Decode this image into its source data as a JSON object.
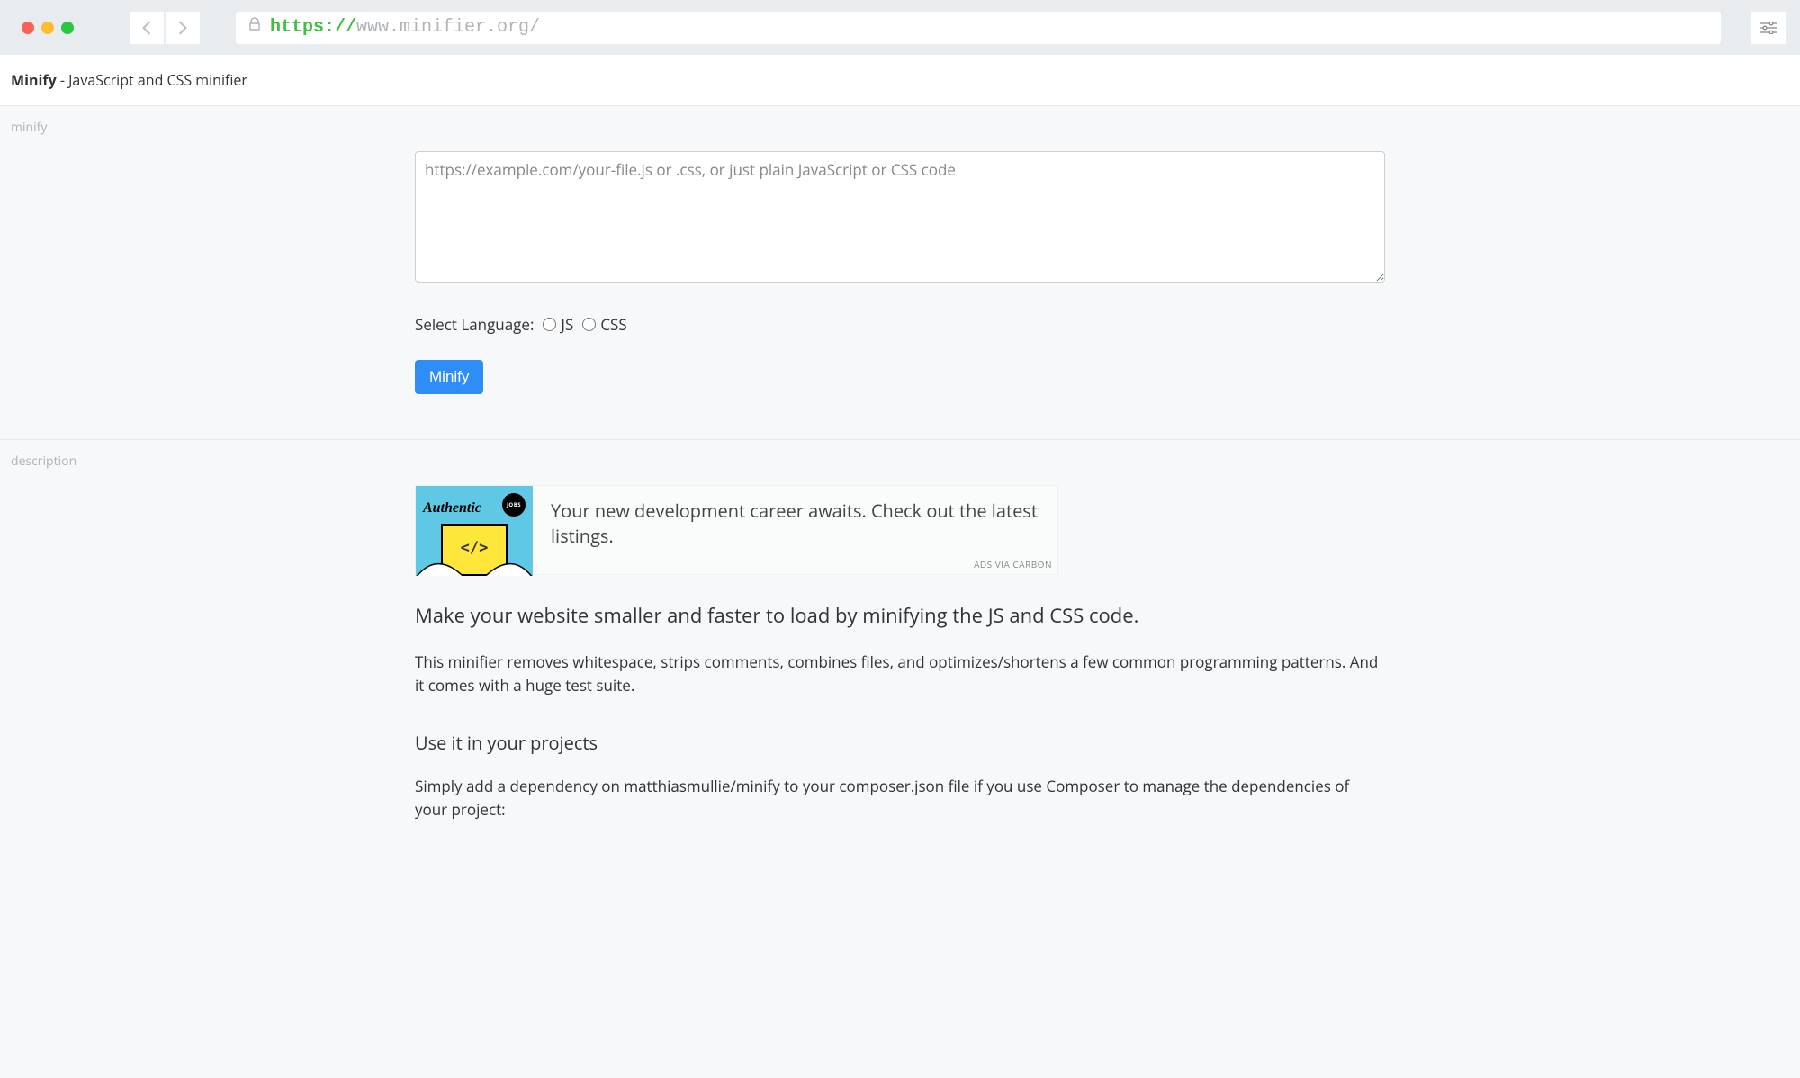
{
  "browser": {
    "url_protocol": "https://",
    "url_rest": "www.minifier.org/"
  },
  "header": {
    "brand": "Minify",
    "tagline": " - JavaScript and CSS minifier"
  },
  "sections": {
    "minify_label": "minify",
    "description_label": "description"
  },
  "form": {
    "placeholder": "https://example.com/your-file.js or .css, or just plain JavaScript or CSS code",
    "select_language_label": "Select Language:",
    "lang_js": "JS",
    "lang_css": "CSS",
    "submit_label": "Minify"
  },
  "ad": {
    "brand_script": "Authentic",
    "jobs_badge": "JOBS",
    "code_glyph": "</>",
    "text": "Your new development career awaits. Check out the latest listings.",
    "via": "ADS VIA CARBON"
  },
  "description": {
    "headline": "Make your website smaller and faster to load by minifying the JS and CSS code.",
    "para1": "This minifier removes whitespace, strips comments, combines files, and optimizes/shortens a few common programming patterns. And it comes with a huge test suite.",
    "subhead": "Use it in your projects",
    "para2": "Simply add a dependency on matthiasmullie/minify to your composer.json file if you use Composer to manage the dependencies of your project:"
  }
}
